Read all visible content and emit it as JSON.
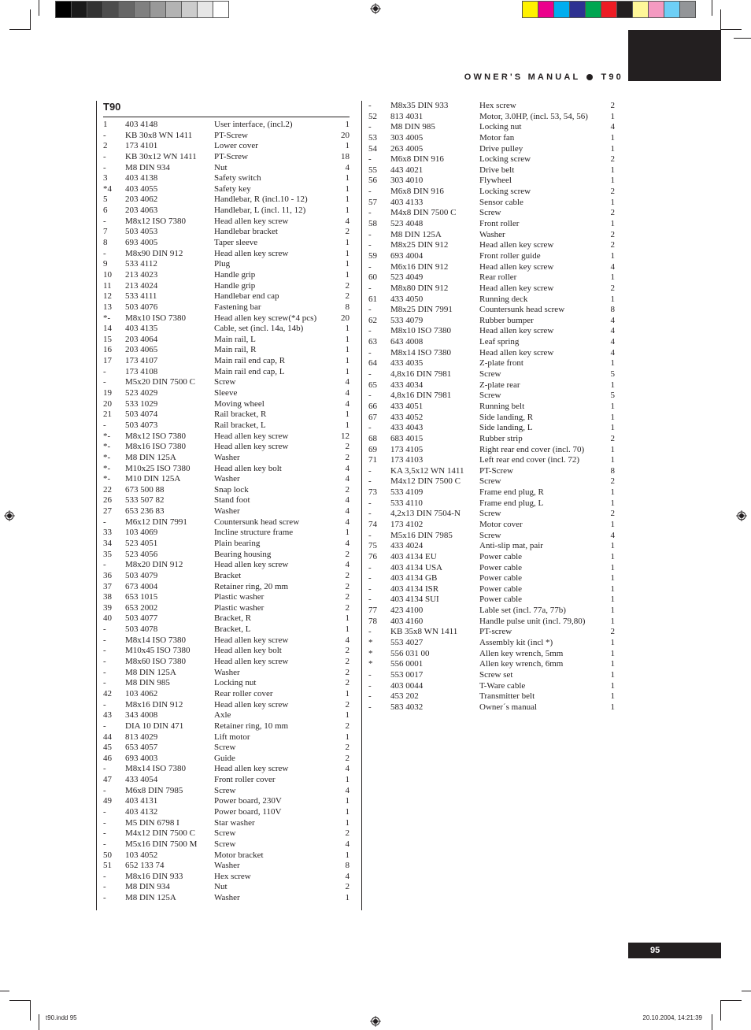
{
  "header": {
    "title": "OWNER'S MANUAL",
    "model": "T90"
  },
  "colors": {
    "grayscale": [
      "#000000",
      "#1a1a1a",
      "#333333",
      "#4d4d4d",
      "#666666",
      "#808080",
      "#999999",
      "#b3b3b3",
      "#cccccc",
      "#e6e6e6",
      "#ffffff"
    ],
    "process": [
      "#fff200",
      "#ec008c",
      "#00aeef",
      "#2e3192",
      "#00a651",
      "#ed1c24",
      "#231f20",
      "#fff799",
      "#f49ac1",
      "#6dcff6",
      "#939598"
    ]
  },
  "section_title": "T90",
  "parts_left": [
    [
      "1",
      "403 4148",
      "User interface, (incl.2)",
      "1"
    ],
    [
      "-",
      "KB 30x8 WN 1411",
      "PT-Screw",
      "20"
    ],
    [
      "2",
      "173 4101",
      "Lower cover",
      "1"
    ],
    [
      "-",
      "KB 30x12 WN 1411",
      "PT-Screw",
      "18"
    ],
    [
      "-",
      "M8 DIN 934",
      "Nut",
      "4"
    ],
    [
      "3",
      "403 4138",
      "Safety switch",
      "1"
    ],
    [
      "*4",
      "403 4055",
      "Safety key",
      "1"
    ],
    [
      "5",
      "203 4062",
      "Handlebar, R (incl.10 - 12)",
      "1"
    ],
    [
      "6",
      "203 4063",
      "Handlebar, L (incl. 11, 12)",
      "1"
    ],
    [
      "-",
      "M8x12 ISO 7380",
      "Head allen key screw",
      "4"
    ],
    [
      "7",
      "503 4053",
      "Handlebar bracket",
      "2"
    ],
    [
      "8",
      "693 4005",
      "Taper sleeve",
      "1"
    ],
    [
      "-",
      "M8x90 DIN 912",
      "Head allen key screw",
      "1"
    ],
    [
      "9",
      "533 4112",
      "Plug",
      "1"
    ],
    [
      "10",
      "213 4023",
      "Handle grip",
      "1"
    ],
    [
      "11",
      "213 4024",
      "Handle grip",
      "2"
    ],
    [
      "12",
      "533 4111",
      "Handlebar end cap",
      "2"
    ],
    [
      "13",
      "503 4076",
      "Fastening bar",
      "8"
    ],
    [
      "*-",
      "M8x10 ISO 7380",
      "Head allen key screw(*4 pcs)",
      "20"
    ],
    [
      "14",
      "403 4135",
      "Cable, set (incl. 14a, 14b)",
      "1"
    ],
    [
      "15",
      "203 4064",
      "Main rail, L",
      "1"
    ],
    [
      "16",
      "203 4065",
      "Main rail, R",
      "1"
    ],
    [
      "17",
      "173 4107",
      "Main rail end cap, R",
      "1"
    ],
    [
      "-",
      "173 4108",
      "Main rail end cap, L",
      "1"
    ],
    [
      "-",
      "M5x20 DIN 7500 C",
      "Screw",
      "4"
    ],
    [
      "19",
      "523 4029",
      "Sleeve",
      "4"
    ],
    [
      "20",
      "533 1029",
      "Moving wheel",
      "4"
    ],
    [
      "21",
      "503 4074",
      "Rail bracket, R",
      "1"
    ],
    [
      "-",
      "503 4073",
      "Rail bracket, L",
      "1"
    ],
    [
      "*-",
      "M8x12 ISO 7380",
      "Head allen key screw",
      "12"
    ],
    [
      "*-",
      "M8x16 ISO 7380",
      "Head allen key screw",
      "2"
    ],
    [
      "*-",
      "M8 DIN 125A",
      "Washer",
      "2"
    ],
    [
      "*-",
      "M10x25 ISO 7380",
      "Head allen key bolt",
      "4"
    ],
    [
      "*-",
      "M10 DIN 125A",
      "Washer",
      "4"
    ],
    [
      "22",
      "673 500 88",
      "Snap lock",
      "2"
    ],
    [
      "26",
      "533 507 82",
      "Stand foot",
      "4"
    ],
    [
      "27",
      "653 236 83",
      "Washer",
      "4"
    ],
    [
      "-",
      "M6x12 DIN 7991",
      "Countersunk head screw",
      "4"
    ],
    [
      "33",
      "103 4069",
      "Incline structure frame",
      "1"
    ],
    [
      "34",
      "523 4051",
      "Plain bearing",
      "4"
    ],
    [
      "35",
      "523 4056",
      "Bearing housing",
      "2"
    ],
    [
      "-",
      "M8x20 DIN 912",
      "Head allen key screw",
      "4"
    ],
    [
      "36",
      "503 4079",
      "Bracket",
      "2"
    ],
    [
      "37",
      "673 4004",
      "Retainer ring, 20 mm",
      "2"
    ],
    [
      "38",
      "653 1015",
      "Plastic washer",
      "2"
    ],
    [
      "39",
      "653 2002",
      "Plastic washer",
      "2"
    ],
    [
      "40",
      "503 4077",
      "Bracket, R",
      "1"
    ],
    [
      "-",
      "503 4078",
      "Bracket, L",
      "1"
    ],
    [
      "-",
      "M8x14 ISO 7380",
      "Head allen key screw",
      "4"
    ],
    [
      "-",
      "M10x45 ISO 7380",
      "Head allen key bolt",
      "2"
    ],
    [
      "-",
      "M8x60 ISO 7380",
      "Head allen key screw",
      "2"
    ],
    [
      "-",
      "M8 DIN 125A",
      "Washer",
      "2"
    ],
    [
      "-",
      "M8 DIN 985",
      "Locking nut",
      "2"
    ],
    [
      "42",
      "103 4062",
      "Rear roller cover",
      "1"
    ],
    [
      "-",
      "M8x16 DIN 912",
      "Head allen key screw",
      "2"
    ],
    [
      "43",
      "343 4008",
      "Axle",
      "1"
    ],
    [
      "-",
      "DIA 10 DIN 471",
      "Retainer ring, 10 mm",
      "2"
    ],
    [
      "44",
      "813 4029",
      "Lift motor",
      "1"
    ],
    [
      "45",
      "653 4057",
      "Screw",
      "2"
    ],
    [
      "46",
      "693 4003",
      "Guide",
      "2"
    ],
    [
      "-",
      "M8x14 ISO 7380",
      "Head allen key screw",
      "4"
    ],
    [
      "47",
      "433 4054",
      "Front roller cover",
      "1"
    ],
    [
      "-",
      "M6x8 DIN 7985",
      "Screw",
      "4"
    ],
    [
      "49",
      "403 4131",
      "Power board, 230V",
      "1"
    ],
    [
      "-",
      "403 4132",
      "Power board, 110V",
      "1"
    ],
    [
      "-",
      "M5 DIN 6798 I",
      "Star washer",
      "1"
    ],
    [
      "-",
      "M4x12 DIN 7500 C",
      "Screw",
      "2"
    ],
    [
      "-",
      "M5x16 DIN 7500 M",
      "Screw",
      "4"
    ],
    [
      "50",
      "103 4052",
      "Motor bracket",
      "1"
    ],
    [
      "51",
      "652 133 74",
      "Washer",
      "8"
    ],
    [
      "-",
      "M8x16 DIN 933",
      "Hex screw",
      "4"
    ],
    [
      "-",
      "M8 DIN 934",
      "Nut",
      "2"
    ],
    [
      "-",
      "M8 DIN 125A",
      "Washer",
      "1"
    ]
  ],
  "parts_right": [
    [
      "-",
      "M8x35 DIN 933",
      "Hex screw",
      "2"
    ],
    [
      "52",
      "813 4031",
      "Motor, 3.0HP, (incl. 53, 54, 56)",
      "1"
    ],
    [
      "-",
      "M8 DIN 985",
      "Locking nut",
      "4"
    ],
    [
      "53",
      "303 4005",
      "Motor fan",
      "1"
    ],
    [
      "54",
      "263 4005",
      "Drive pulley",
      "1"
    ],
    [
      "-",
      "M6x8 DIN 916",
      "Locking screw",
      "2"
    ],
    [
      "55",
      "443 4021",
      "Drive belt",
      "1"
    ],
    [
      "56",
      "303 4010",
      "Flywheel",
      "1"
    ],
    [
      "-",
      "M6x8 DIN 916",
      "Locking screw",
      "2"
    ],
    [
      "57",
      "403 4133",
      "Sensor cable",
      "1"
    ],
    [
      "-",
      "M4x8 DIN 7500 C",
      "Screw",
      "2"
    ],
    [
      "58",
      "523 4048",
      "Front roller",
      "1"
    ],
    [
      "-",
      "M8 DIN 125A",
      "Washer",
      "2"
    ],
    [
      "-",
      "M8x25 DIN 912",
      "Head allen key screw",
      "2"
    ],
    [
      "59",
      "693 4004",
      "Front roller guide",
      "1"
    ],
    [
      "-",
      "M6x16 DIN 912",
      "Head allen key screw",
      "4"
    ],
    [
      "60",
      "523 4049",
      "Rear roller",
      "1"
    ],
    [
      "-",
      "M8x80 DIN 912",
      "Head allen key screw",
      "2"
    ],
    [
      "61",
      "433 4050",
      "Running deck",
      "1"
    ],
    [
      "-",
      "M8x25 DIN 7991",
      "Countersunk head screw",
      "8"
    ],
    [
      "62",
      "533 4079",
      "Rubber bumper",
      "4"
    ],
    [
      "-",
      "M8x10 ISO 7380",
      "Head allen key screw",
      "4"
    ],
    [
      "63",
      "643 4008",
      "Leaf spring",
      "4"
    ],
    [
      "-",
      "M8x14 ISO 7380",
      "Head allen key screw",
      "4"
    ],
    [
      "64",
      "433 4035",
      "Z-plate front",
      "1"
    ],
    [
      "-",
      "4,8x16 DIN 7981",
      "Screw",
      "5"
    ],
    [
      "65",
      "433 4034",
      "Z-plate rear",
      "1"
    ],
    [
      "-",
      "4,8x16 DIN 7981",
      "Screw",
      "5"
    ],
    [
      "66",
      "433 4051",
      "Running belt",
      "1"
    ],
    [
      "67",
      "433 4052",
      "Side landing, R",
      "1"
    ],
    [
      "-",
      "433 4043",
      "Side landing, L",
      "1"
    ],
    [
      "68",
      "683 4015",
      "Rubber strip",
      "2"
    ],
    [
      "69",
      "173 4105",
      "Right rear end cover  (incl. 70)",
      "1"
    ],
    [
      "71",
      "173 4103",
      "Left rear end cover  (incl. 72)",
      "1"
    ],
    [
      "-",
      "KA 3,5x12 WN 1411",
      "PT-Screw",
      "8"
    ],
    [
      "-",
      "M4x12 DIN 7500 C",
      "Screw",
      "2"
    ],
    [
      "73",
      "533 4109",
      "Frame end plug, R",
      "1"
    ],
    [
      "-",
      "533 4110",
      "Frame end plug, L",
      "1"
    ],
    [
      "-",
      "4,2x13 DIN 7504-N",
      "Screw",
      "2"
    ],
    [
      "74",
      "173 4102",
      "Motor cover",
      "1"
    ],
    [
      "-",
      "M5x16 DIN 7985",
      "Screw",
      "4"
    ],
    [
      "75",
      "433 4024",
      "Anti-slip mat, pair",
      "1"
    ],
    [
      "76",
      "403 4134 EU",
      "Power cable",
      "1"
    ],
    [
      "-",
      "403 4134 USA",
      "Power cable",
      "1"
    ],
    [
      "-",
      "403 4134 GB",
      "Power cable",
      "1"
    ],
    [
      "-",
      "403 4134 ISR",
      "Power cable",
      "1"
    ],
    [
      "-",
      "403 4134 SUI",
      "Power cable",
      "1"
    ],
    [
      "77",
      "423 4100",
      "Lable set (incl. 77a, 77b)",
      "1"
    ],
    [
      "78",
      "403 4160",
      "Handle pulse unit (incl. 79,80)",
      "1"
    ],
    [
      "-",
      "KB 35x8 WN 1411",
      "PT-screw",
      "2"
    ],
    [
      "*",
      "553 4027",
      "Assembly kit (incl *)",
      "1"
    ],
    [
      "*",
      "556 031 00",
      "Allen key wrench, 5mm",
      "1"
    ],
    [
      "*",
      "556 0001",
      "Allen key wrench, 6mm",
      "1"
    ],
    [
      "-",
      "553 0017",
      "Screw set",
      "1"
    ],
    [
      "-",
      "403 0044",
      "T-Ware cable",
      "1"
    ],
    [
      "-",
      "453 202",
      "Transmitter belt",
      "1"
    ],
    [
      "-",
      "583 4032",
      "Owner´s manual",
      "1"
    ]
  ],
  "page_number": "95",
  "footer": {
    "file": "t90.indd   95",
    "timestamp": "20.10.2004, 14:21:39"
  }
}
